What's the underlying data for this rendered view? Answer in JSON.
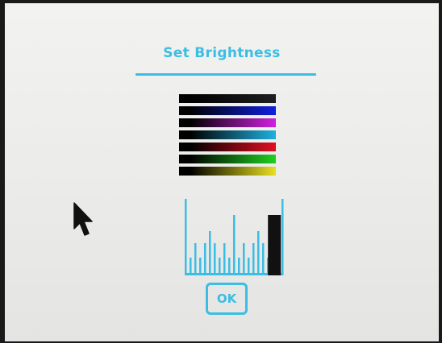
{
  "dialog": {
    "title": "Set Brightness",
    "ok_label": "OK"
  },
  "colors": {
    "accent": "#3bbde4",
    "handle": "#111111",
    "bg": "#efefed"
  },
  "test_bars": [
    {
      "name": "gray",
      "end_color": "#1f1f1f"
    },
    {
      "name": "blue",
      "end_color": "#1020e0"
    },
    {
      "name": "magenta",
      "end_color": "#d020e0"
    },
    {
      "name": "cyan",
      "end_color": "#20b0e0"
    },
    {
      "name": "red",
      "end_color": "#e01020"
    },
    {
      "name": "green",
      "end_color": "#20d020"
    },
    {
      "name": "yellow",
      "end_color": "#e8e020"
    }
  ],
  "brightness": {
    "level": 0.96,
    "ticks": 21
  },
  "icons": {
    "pointer": "arrow-cursor-icon"
  }
}
